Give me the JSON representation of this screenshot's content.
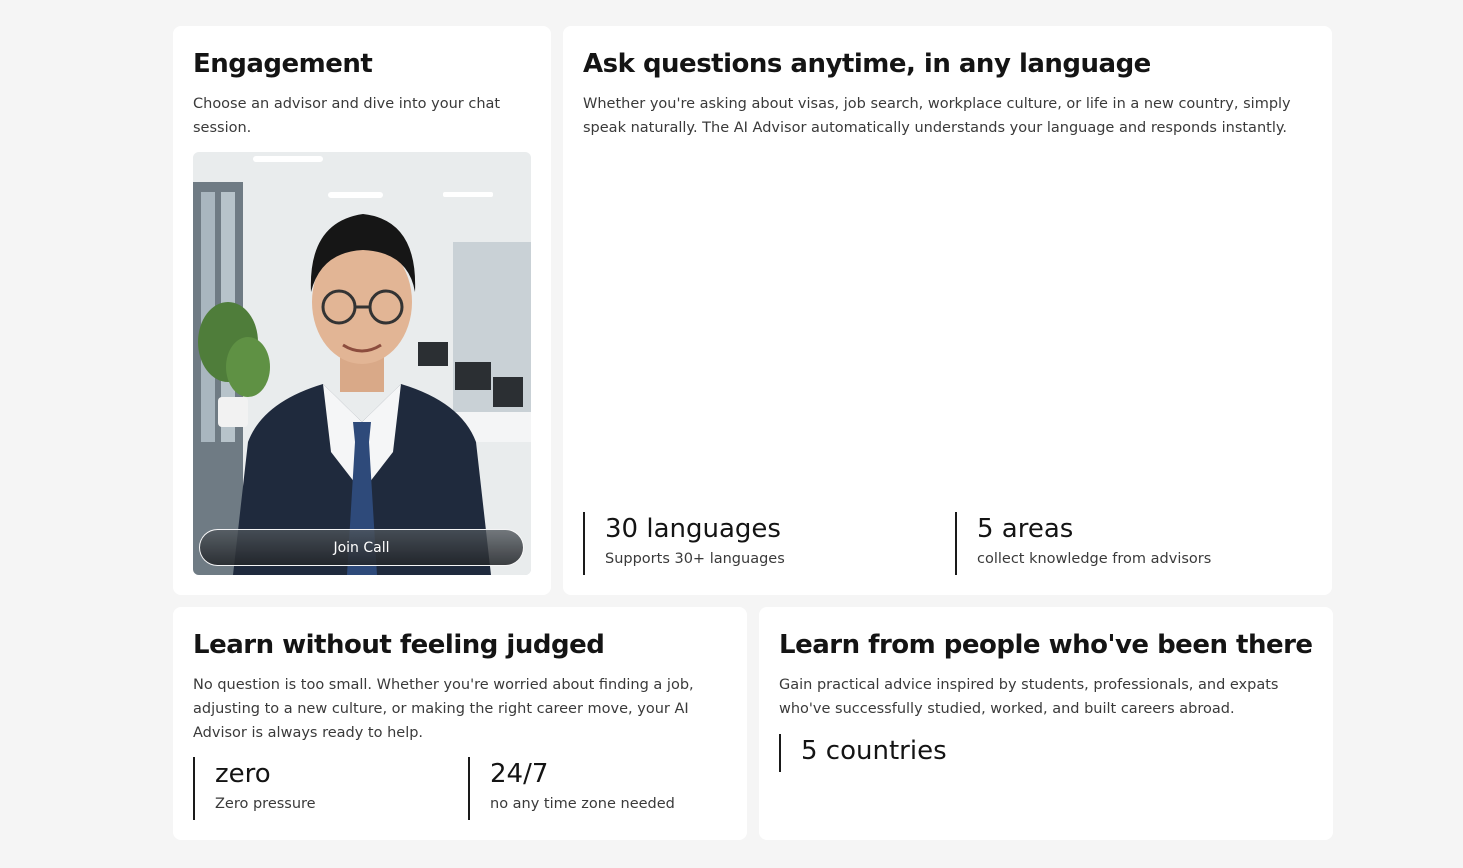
{
  "engagement": {
    "title": "Engagement",
    "description": "Choose an advisor and dive into your chat session.",
    "join_button": "Join Call"
  },
  "ask": {
    "title": "Ask questions anytime, in any language",
    "description": "Whether you're asking about visas, job search, workplace culture, or life in a new country, simply speak naturally. The AI Advisor automatically understands your language and responds instantly.",
    "stats": [
      {
        "value": "30 languages",
        "label": "Supports 30+ languages"
      },
      {
        "value": "5 areas",
        "label": "collect knowledge from advisors"
      }
    ]
  },
  "judged": {
    "title": "Learn without feeling judged",
    "description": "No question is too small. Whether you're worried about finding a job, adjusting to a new culture, or making the right career move, your AI Advisor is always ready to help.",
    "stats": [
      {
        "value": "zero",
        "label": "Zero pressure"
      },
      {
        "value": "24/7",
        "label": "no any time zone needed"
      }
    ]
  },
  "people": {
    "title": "Learn from people who've been there",
    "description": "Gain practical advice inspired by students, professionals, and expats who've successfully studied, worked, and built careers abroad.",
    "stats": [
      {
        "value": "5 countries"
      }
    ]
  }
}
